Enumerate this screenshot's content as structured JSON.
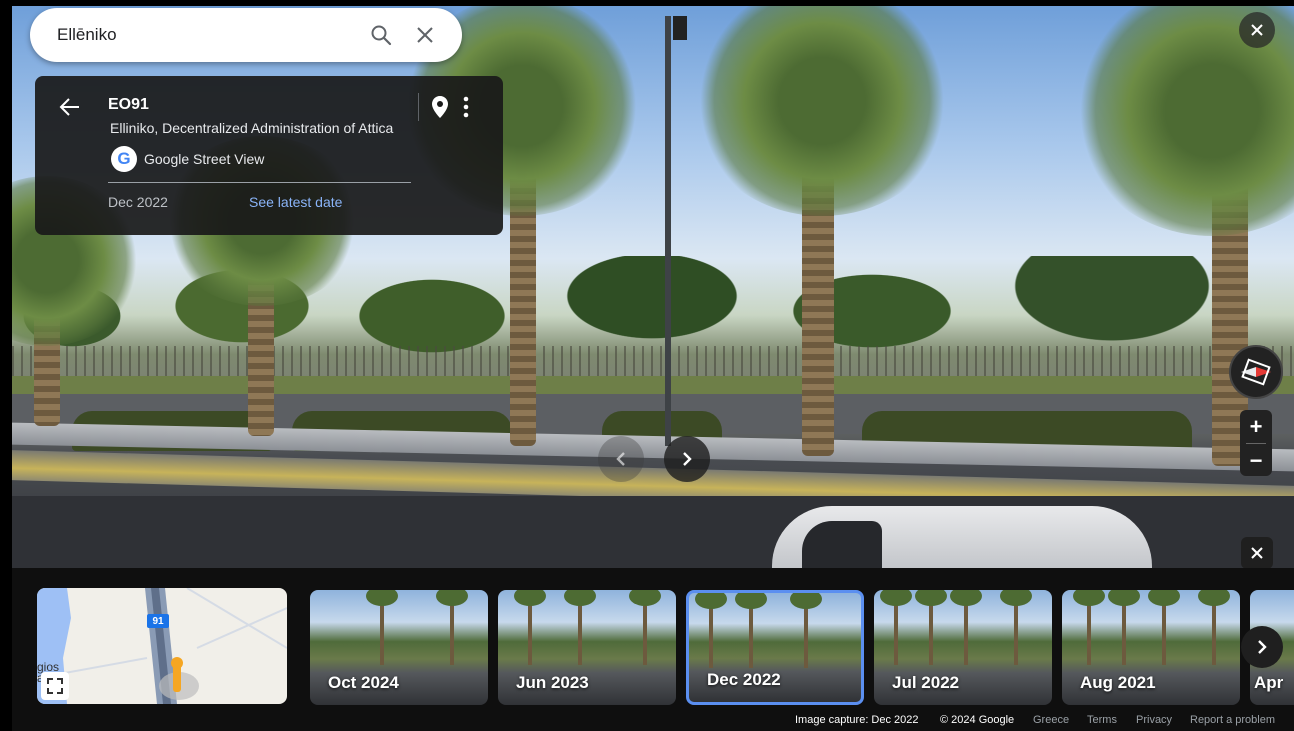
{
  "search": {
    "value": "Ellēniko"
  },
  "card": {
    "title": "EO91",
    "address": "Elliniko, Decentralized Administration of Attica",
    "logo_letter": "G",
    "source": "Google Street View",
    "date": "Dec 2022",
    "latest_link": "See latest date"
  },
  "map": {
    "road_label": "91",
    "partial_text": "gios\na"
  },
  "timeline": [
    {
      "label": "Oct 2024"
    },
    {
      "label": "Jun 2023"
    },
    {
      "label": "Dec 2022",
      "selected": true
    },
    {
      "label": "Jul 2022"
    },
    {
      "label": "Aug 2021"
    },
    {
      "label": "Apr"
    }
  ],
  "footer": {
    "capture": "Image capture: Dec 2022",
    "copyright": "© 2024 Google",
    "country": "Greece",
    "terms": "Terms",
    "privacy": "Privacy",
    "report": "Report a problem"
  },
  "zoom": {
    "in": "+",
    "out": "−"
  },
  "colors": {
    "accent": "#8ab4f8",
    "selected_border": "#5b8ff0"
  }
}
